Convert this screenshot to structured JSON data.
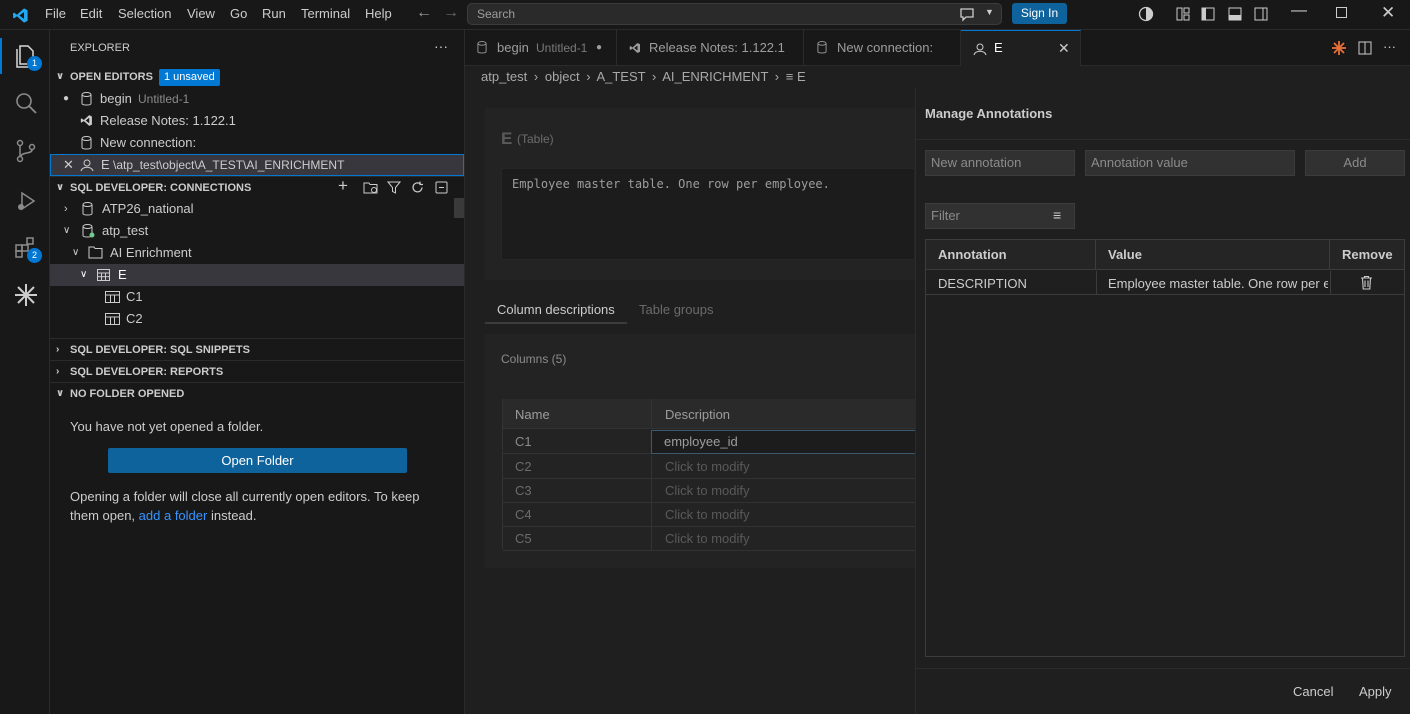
{
  "menu": [
    "File",
    "Edit",
    "Selection",
    "View",
    "Go",
    "Run",
    "Terminal",
    "Help"
  ],
  "search": {
    "placeholder": "Search"
  },
  "signin_label": "Sign In",
  "activity": {
    "explorer_badge": "1",
    "extensions_badge": "2"
  },
  "sidebar": {
    "title": "EXPLORER",
    "open_editors": {
      "label": "OPEN EDITORS",
      "badge": "1 unsaved",
      "items": [
        {
          "name": "begin",
          "detail": "Untitled-1"
        },
        {
          "name": "Release Notes: 1.122.1",
          "detail": ""
        },
        {
          "name": "New connection:",
          "detail": ""
        },
        {
          "name": "E",
          "detail": "\\atp_test\\object\\A_TEST\\AI_ENRICHMENT"
        }
      ]
    },
    "connections": {
      "label": "SQL DEVELOPER: CONNECTIONS",
      "items": [
        "ATP26_national",
        "atp_test",
        "AI Enrichment",
        "E",
        "C1",
        "C2"
      ]
    },
    "snippets_label": "SQL DEVELOPER: SQL SNIPPETS",
    "reports_label": "SQL DEVELOPER: REPORTS",
    "no_folder": {
      "label": "NO FOLDER OPENED",
      "message": "You have not yet opened a folder.",
      "button": "Open Folder",
      "note_before": "Opening a folder will close all currently open editors. To keep them open,",
      "link": "add a folder",
      "note_after": "instead."
    }
  },
  "tabs": [
    {
      "name": "begin",
      "detail": "Untitled-1"
    },
    {
      "name": "Release Notes: 1.122.1",
      "detail": ""
    },
    {
      "name": "New connection:",
      "detail": ""
    },
    {
      "name": "E",
      "detail": ""
    }
  ],
  "breadcrumb": [
    "atp_test",
    "object",
    "A_TEST",
    "AI_ENRICHMENT",
    "E"
  ],
  "editor": {
    "table_name": "E",
    "table_type": "(Table)",
    "description": "Employee master table. One row per employee.",
    "subtabs": [
      "Column descriptions",
      "Table groups"
    ],
    "columns_label": "Columns (5)",
    "headers": [
      "Name",
      "Description"
    ],
    "rows": [
      {
        "name": "C1",
        "desc": "employee_id"
      },
      {
        "name": "C2",
        "desc": "Click to modify"
      },
      {
        "name": "C3",
        "desc": "Click to modify"
      },
      {
        "name": "C4",
        "desc": "Click to modify"
      },
      {
        "name": "C5",
        "desc": "Click to modify"
      }
    ]
  },
  "dialog": {
    "title": "Manage Annotations",
    "new_annotation_placeholder": "New annotation",
    "value_placeholder": "Annotation value",
    "add_label": "Add",
    "filter_placeholder": "Filter",
    "headers": [
      "Annotation",
      "Value",
      "Remove"
    ],
    "rows": [
      {
        "annotation": "DESCRIPTION",
        "value": "Employee master table. One row per e"
      }
    ],
    "cancel_label": "Cancel",
    "apply_label": "Apply"
  },
  "colors": {
    "accent": "#0078d4",
    "button": "#0e639c",
    "link": "#3794ff"
  }
}
